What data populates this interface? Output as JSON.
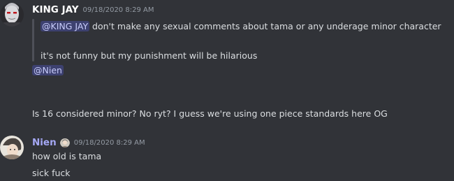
{
  "messages": [
    {
      "username": "KING JAY",
      "username_color": "#ffffff",
      "timestamp": "09/18/2020 8:29 AM",
      "quote": {
        "mention": "@KING JAY",
        "text": " don't make any sexual comments about tama or any underage minor character",
        "line2": "it's not funny but my punishment will be hilarious"
      },
      "reply_mention": "@Nien",
      "body": "Is 16 considered minor? No ryt? I guess we're using one piece standards here OG"
    },
    {
      "username": "Nien",
      "username_color": "#a5a8f5",
      "timestamp": "09/18/2020 8:29 AM",
      "lines": [
        "how old is tama",
        "sick fuck"
      ]
    }
  ],
  "colors": {
    "background": "#313338",
    "text": "#dbdee1",
    "timestamp": "#949ba4",
    "mention_bg": "rgba(88,101,242,0.3)",
    "mention_text": "#c9cdfb"
  }
}
